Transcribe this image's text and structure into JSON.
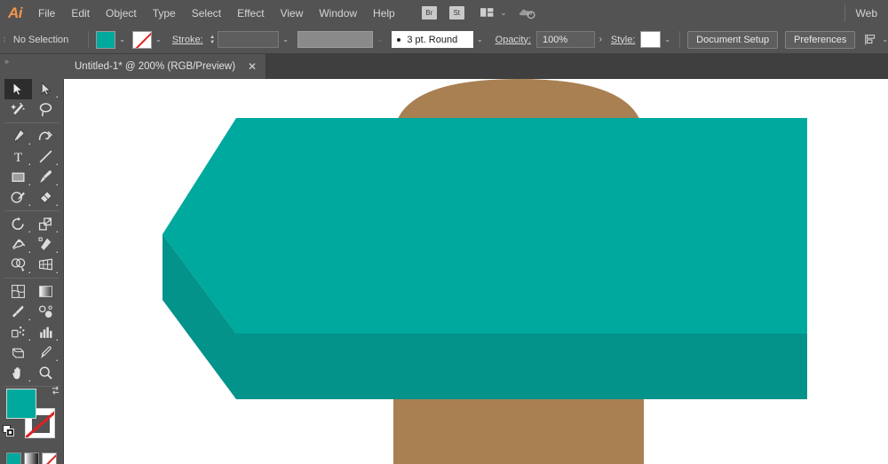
{
  "app": {
    "name": "Adobe Illustrator",
    "logo_text": "Ai"
  },
  "menubar": {
    "items": [
      {
        "label": "File",
        "name": "menu-file"
      },
      {
        "label": "Edit",
        "name": "menu-edit"
      },
      {
        "label": "Object",
        "name": "menu-object"
      },
      {
        "label": "Type",
        "name": "menu-type"
      },
      {
        "label": "Select",
        "name": "menu-select"
      },
      {
        "label": "Effect",
        "name": "menu-effect"
      },
      {
        "label": "View",
        "name": "menu-view"
      },
      {
        "label": "Window",
        "name": "menu-window"
      },
      {
        "label": "Help",
        "name": "menu-help"
      }
    ],
    "bridge_label": "Br",
    "stock_label": "St",
    "arrange_icon": "arrange-documents-icon",
    "arrange_chevron": "⌄",
    "cloud_icon": "sync-cloud-icon",
    "workspace_label": "Web"
  },
  "controlbar": {
    "selection_status": "No Selection",
    "fill_color": "#00a99d",
    "fill_chevron": "⌄",
    "stroke_color": "none",
    "stroke_chevron": "⌄",
    "stroke_label": "Stroke:",
    "stroke_weight": "",
    "stroke_weight_chevron": "⌄",
    "variable_width_profile": "",
    "variable_width_chevron": "⌄",
    "brush_definition": "3 pt. Round",
    "brush_chevron": "⌄",
    "opacity_label": "Opacity:",
    "opacity_value": "100%",
    "opacity_arrow": "›",
    "style_label": "Style:",
    "style_chevron": "⌄",
    "document_setup_label": "Document Setup",
    "preferences_label": "Preferences",
    "align_icon": "align-objects-icon",
    "align_chevron": "⌄"
  },
  "tabbar": {
    "grip": "»",
    "document_title": "Untitled-1* @ 200% (RGB/Preview)",
    "close_glyph": "✕"
  },
  "toolbar": {
    "grip": "»",
    "tools": [
      {
        "name": "selection-tool",
        "label": "Selection",
        "active": true,
        "corner": false
      },
      {
        "name": "direct-selection-tool",
        "label": "Direct Selection",
        "active": false,
        "corner": true
      },
      {
        "name": "magic-wand-tool",
        "label": "Magic Wand",
        "active": false,
        "corner": false
      },
      {
        "name": "lasso-tool",
        "label": "Lasso",
        "active": false,
        "corner": false
      },
      {
        "name": "pen-tool",
        "label": "Pen",
        "active": false,
        "corner": true
      },
      {
        "name": "curvature-tool",
        "label": "Curvature",
        "active": false,
        "corner": false
      },
      {
        "name": "type-tool",
        "label": "Type",
        "active": false,
        "corner": true
      },
      {
        "name": "line-segment-tool",
        "label": "Line Segment",
        "active": false,
        "corner": true
      },
      {
        "name": "rectangle-tool",
        "label": "Rectangle",
        "active": false,
        "corner": true
      },
      {
        "name": "paintbrush-tool",
        "label": "Paintbrush",
        "active": false,
        "corner": true
      },
      {
        "name": "shaper-tool",
        "label": "Shaper",
        "active": false,
        "corner": true
      },
      {
        "name": "eraser-tool",
        "label": "Eraser",
        "active": false,
        "corner": true
      },
      {
        "name": "rotate-tool",
        "label": "Rotate",
        "active": false,
        "corner": true
      },
      {
        "name": "scale-tool",
        "label": "Scale",
        "active": false,
        "corner": true
      },
      {
        "name": "width-tool",
        "label": "Width",
        "active": false,
        "corner": true
      },
      {
        "name": "free-transform-tool",
        "label": "Free Transform",
        "active": false,
        "corner": true
      },
      {
        "name": "shape-builder-tool",
        "label": "Shape Builder",
        "active": false,
        "corner": true
      },
      {
        "name": "perspective-grid-tool",
        "label": "Perspective Grid",
        "active": false,
        "corner": true
      },
      {
        "name": "mesh-tool",
        "label": "Mesh",
        "active": false,
        "corner": false
      },
      {
        "name": "gradient-tool",
        "label": "Gradient",
        "active": false,
        "corner": false
      },
      {
        "name": "eyedropper-tool",
        "label": "Eyedropper",
        "active": false,
        "corner": true
      },
      {
        "name": "blend-tool",
        "label": "Blend",
        "active": false,
        "corner": false
      },
      {
        "name": "symbol-sprayer-tool",
        "label": "Symbol Sprayer",
        "active": false,
        "corner": true
      },
      {
        "name": "column-graph-tool",
        "label": "Column Graph",
        "active": false,
        "corner": true
      },
      {
        "name": "artboard-tool",
        "label": "Artboard",
        "active": false,
        "corner": false
      },
      {
        "name": "slice-tool",
        "label": "Slice",
        "active": false,
        "corner": true
      },
      {
        "name": "hand-tool",
        "label": "Hand",
        "active": false,
        "corner": true
      },
      {
        "name": "zoom-tool",
        "label": "Zoom",
        "active": false,
        "corner": false
      }
    ],
    "fill_color": "#00a99d",
    "stroke_color": "none",
    "swap_icon": "swap-fill-stroke-icon",
    "default_icon": "default-fill-stroke-icon",
    "modes": [
      {
        "name": "color-mode-button",
        "label": "Color"
      },
      {
        "name": "gradient-mode-button",
        "label": "Gradient"
      },
      {
        "name": "none-mode-button",
        "label": "None"
      }
    ]
  },
  "canvas": {
    "background": "#ffffff",
    "artwork": {
      "brown_shape": {
        "name": "brown-rounded-rectangle",
        "color": "#a98052",
        "description": "Rounded-top vertical rectangle behind the arrow"
      },
      "arrow_shape": {
        "name": "teal-arrow-banner",
        "light_color": "#00a99d",
        "dark_color": "#03938a",
        "description": "Large left-pointing teal arrow banner with darker lower band"
      }
    }
  }
}
